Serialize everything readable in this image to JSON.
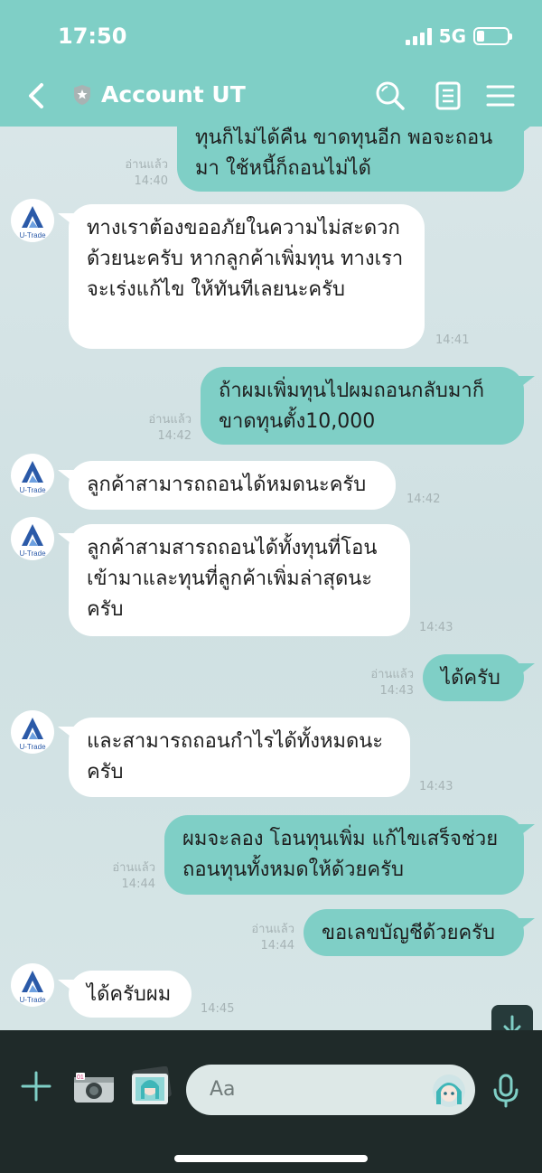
{
  "status_bar": {
    "time": "17:50",
    "network": "5G"
  },
  "header": {
    "title": "Account UT"
  },
  "avatar_logo_text": "U-Trade",
  "messages": [
    {
      "side": "me",
      "text": "ทุนก็ไม่ได้คืน ขาดทุนอีก พอจะถอนมา ใช้หนี้ก็ถอนไม่ได้",
      "read": "อ่านแล้ว",
      "time": "14:40"
    },
    {
      "side": "them",
      "text": "ทางเราต้องขออภัยในความไม่สะดวกด้วยนะครับ หากลูกค้าเพิ่มทุน ทางเราจะเร่งแก้ไข ให้ทันทีเลยนะครับ",
      "time": "14:41"
    },
    {
      "side": "me",
      "text": "ถ้าผมเพิ่มทุนไปผมถอนกลับมาก็ ขาดทุนตั้ง10,000",
      "read": "อ่านแล้ว",
      "time": "14:42"
    },
    {
      "side": "them",
      "text": "ลูกค้าสามารถถอนได้หมดนะครับ",
      "time": "14:42"
    },
    {
      "side": "them",
      "text": "ลูกค้าสามสารถถอนได้ทั้งทุนที่โอน เข้ามาและทุนที่ลูกค้าเพิ่มล่าสุดนะครับ",
      "time": "14:43"
    },
    {
      "side": "me",
      "text": "ได้ครับ",
      "read": "อ่านแล้ว",
      "time": "14:43"
    },
    {
      "side": "them",
      "text": "และสามารถถอนกำไรได้ทั้งหมดนะครับ",
      "time": "14:43"
    },
    {
      "side": "me",
      "text": "ผมจะลอง โอนทุนเพิ่ม แก้ไขเสร็จช่วย ถอนทุนทั้งหมดให้ด้วยครับ",
      "read": "อ่านแล้ว",
      "time": "14:44"
    },
    {
      "side": "me",
      "text": "ขอเลขบัญชีด้วยครับ",
      "read": "อ่านแล้ว",
      "time": "14:44"
    },
    {
      "side": "them",
      "text": "ได้ครับผม",
      "time": "14:45"
    }
  ],
  "input": {
    "placeholder": "Aa"
  },
  "colors": {
    "header": "#7fcfc6",
    "my_bubble": "#7fcfc6",
    "their_bubble": "#ffffff",
    "bottom_bar": "#1f2a29"
  }
}
